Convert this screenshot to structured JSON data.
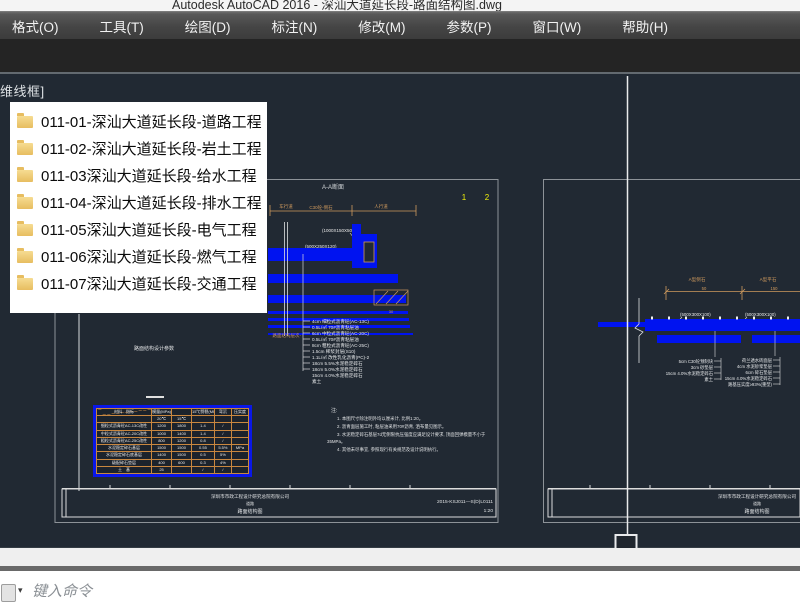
{
  "window": {
    "title": "Autodesk AutoCAD 2016 - 深汕大道延长段-路面结构图.dwg"
  },
  "menu": {
    "items": [
      "格式(O)",
      "工具(T)",
      "绘图(D)",
      "标注(N)",
      "修改(M)",
      "参数(P)",
      "窗口(W)",
      "帮助(H)"
    ]
  },
  "viewport_control": {
    "label": "维线框]"
  },
  "overlay": {
    "items": [
      "011-01-深汕大道延长段-道路工程",
      "011-02-深汕大道延长段-岩土工程",
      "011-03深汕大道延长段-给水工程",
      "011-04-深汕大道延长段-排水工程",
      "011-05深汕大道延长段-电气工程",
      "011-06深汕大道延长段-燃气工程",
      "011-07深汕大道延长段-交通工程"
    ]
  },
  "left_sheet": {
    "section_title": "A-A断面",
    "detail_no_1": "1",
    "detail_no_2": "2",
    "dim_label_left": "车行道",
    "dim_label_mid": "C30砼-侧石",
    "dim_label_right": "人行道",
    "leader_dim_1": "(1000X150X50)",
    "leader_dim_2": "(500X250X120)",
    "curb_dim": "30",
    "layers_label": "路面结构层次-",
    "layers": [
      "4cm 细粒式沥青砼(AC-13C)",
      "0.5L/㎡ 70#沥青粘层油",
      "6cm 中粒式沥青砼(AC-20C)",
      "0.5L/㎡ 70#沥青粘层油",
      "8cm 粗粒式沥青砼(AC-25C)",
      "1.5cm 稀浆封层(S10)",
      "1.1L/㎡ 改性乳化沥青(PC)-2",
      "18cm 5.5%水泥稳定碎石",
      "18cm 5.0%水泥稳定碎石",
      "15cm 4.0%水泥稳定碎石",
      "素土"
    ],
    "table_title": "路面结构设计参数",
    "table": {
      "rows": [
        [
          "材料　指标",
          "模量(MPa)",
          "",
          "15℃劈裂(MPa)",
          "弯沉",
          "压实度"
        ],
        [
          "",
          "20℃",
          "15℃",
          "",
          "",
          ""
        ],
        [
          "细粒式沥青砼AC-13C改性",
          "1200",
          "1800",
          "1.4",
          "/",
          ""
        ],
        [
          "中粒式沥青砼AC-20C改性",
          "1000",
          "1400",
          "1.4",
          "/",
          ""
        ],
        [
          "粗粒式沥青砼AC-25C改性",
          "800",
          "1200",
          "0.8",
          "/",
          ""
        ],
        [
          "水泥稳定碎石基层",
          "1500",
          "1500",
          "0.55",
          "5.5%",
          "MPa"
        ],
        [
          "水泥稳定碎石底基层",
          "1400",
          "1500",
          "0.5",
          "5%",
          ""
        ],
        [
          "级配碎石垫层",
          "400",
          "600",
          "0.3",
          "4%",
          ""
        ],
        [
          "土　基",
          "25",
          "",
          "/",
          "/",
          ""
        ]
      ]
    },
    "notes": [
      "注:",
      "1. 本图尺寸除注明外均以厘米计, 比例1:20。",
      "2. 沥青面层施工时, 粘层油采用70#沥青, 洒布量见图示。",
      "3. 水泥稳定碎石基层7d无侧限抗压强度应满足设计要求, 顶面回弹模量不小于",
      "35MPa。",
      "4. 其他未尽事宜, 参照现行有关规范及设计说明执行。"
    ],
    "title_block": {
      "company": "深圳市市政工程设计研究总院有限公司",
      "project": "道路",
      "sheet_name": "路面结构图",
      "drawing_no": "2015-KSJ011—S(D)L0111",
      "scale": "1:20"
    }
  },
  "right_sheet": {
    "dim_label_1": "A型侧石",
    "dim_label_2": "A型平石",
    "dim_value_1": "50",
    "dim_value_2": "150",
    "leader_dim_1": "(500X300X100)",
    "leader_dim_2": "(500X300X100)",
    "annotations_left": [
      "5cm C30砼预制块",
      "3cm 砂垫层",
      "15cm 4.0%水泥稳定碎石",
      "素土"
    ],
    "annotations_right": [
      "荷兰透水砖面层",
      "4cm 水泥砂浆垫层",
      "6cm 碎石垫层",
      "15cm 4.0%水泥稳定碎石",
      "路基压实度≥93%(重型)"
    ],
    "title_block": {
      "company": "深圳市市政工程设计研究总院有限公司",
      "project": "道路",
      "sheet_name": "路面结构图"
    }
  },
  "command_line": {
    "placeholder": "键入命令",
    "dropdown_icon": "▾"
  },
  "colors": {
    "canvas": "#212933",
    "cad_blue": "#0013f0",
    "cad_orange": "#cf9a5e",
    "cad_yellow": "#f0f00a",
    "sheet_border": "#8d9298"
  }
}
